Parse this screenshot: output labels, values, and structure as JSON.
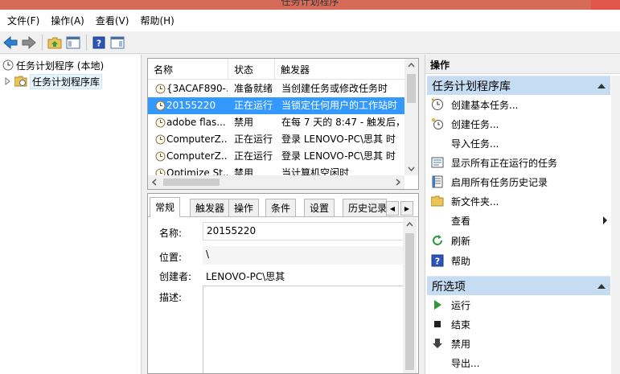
{
  "window": {
    "title": "任务计划程序"
  },
  "menu": [
    {
      "label": "文件(F)"
    },
    {
      "label": "操作(A)"
    },
    {
      "label": "查看(V)"
    },
    {
      "label": "帮助(H)"
    }
  ],
  "tree": {
    "root": "任务计划程序 (本地)",
    "child": "任务计划程序库"
  },
  "tasks": {
    "columns": [
      "名称",
      "状态",
      "触发器"
    ],
    "rows": [
      {
        "name": "{3ACAF890-...",
        "status": "准备就绪",
        "trigger": "当创建任务或修改任务时"
      },
      {
        "name": "20155220",
        "status": "正在运行",
        "trigger": "当锁定任何用户的工作站时"
      },
      {
        "name": "adobe flas...",
        "status": "禁用",
        "trigger": "在每 7 天的 8:47 - 触发后，"
      },
      {
        "name": "ComputerZ...",
        "status": "正在运行",
        "trigger": "登录 LENOVO-PC\\思其 时"
      },
      {
        "name": "ComputerZ...",
        "status": "正在运行",
        "trigger": "登录 LENOVO-PC\\思其 时"
      },
      {
        "name": "Optimize St...",
        "status": "禁用",
        "trigger": "当计算机空闲时"
      }
    ]
  },
  "detail": {
    "tabs": [
      "常规",
      "触发器",
      "操作",
      "条件",
      "设置",
      "历史记录"
    ],
    "name_label": "名称:",
    "name_value": "20155220",
    "location_label": "位置:",
    "location_value": "\\",
    "author_label": "创建者:",
    "author_value": "LENOVO-PC\\思其",
    "description_label": "描述:"
  },
  "actions": {
    "title": "操作",
    "section1": {
      "title": "任务计划程序库",
      "items": [
        {
          "label": "创建基本任务...",
          "icon": "create-basic-task-icon"
        },
        {
          "label": "创建任务...",
          "icon": "create-task-icon"
        },
        {
          "label": "导入任务...",
          "icon": ""
        },
        {
          "label": "显示所有正在运行的任务",
          "icon": "running-tasks-icon"
        },
        {
          "label": "启用所有任务历史记录",
          "icon": "history-icon"
        },
        {
          "label": "新文件夹...",
          "icon": "new-folder-icon"
        },
        {
          "label": "查看",
          "icon": ""
        },
        {
          "label": "刷新",
          "icon": "refresh-icon"
        },
        {
          "label": "帮助",
          "icon": "help-icon"
        }
      ]
    },
    "section2": {
      "title": "所选项",
      "items": [
        {
          "label": "运行",
          "icon": "run-icon"
        },
        {
          "label": "结束",
          "icon": "end-icon"
        },
        {
          "label": "禁用",
          "icon": "disable-icon"
        },
        {
          "label": "导出...",
          "icon": ""
        }
      ]
    }
  },
  "colors": {
    "selection": "#3399ff",
    "section_header": "#c5dcf3",
    "titlebar": "#d66b5a"
  }
}
